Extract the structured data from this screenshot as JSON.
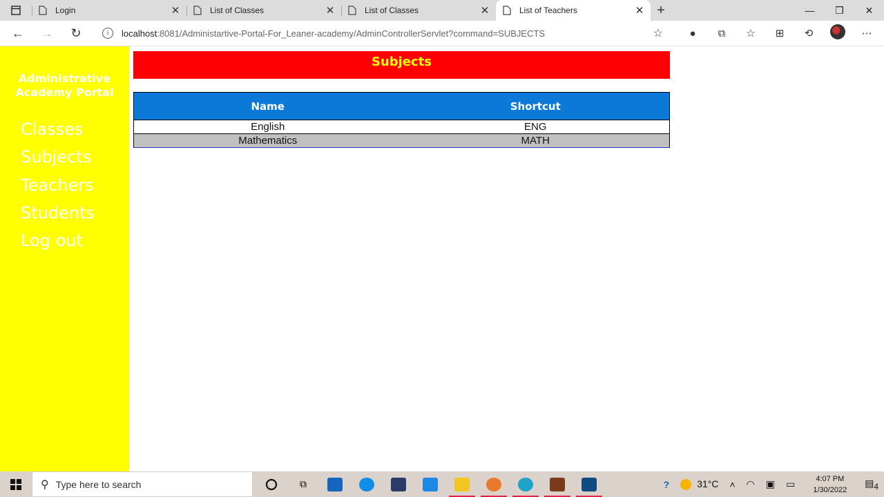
{
  "browser": {
    "tabs": [
      {
        "title": "Login",
        "active": false
      },
      {
        "title": "List of Classes",
        "active": false
      },
      {
        "title": "List of Classes",
        "active": false
      },
      {
        "title": "List of Teachers",
        "active": true
      }
    ],
    "url_host": "localhost",
    "url_rest": ":8081/Administartive-Portal-For_Leaner-academy/AdminControllerServlet?command=SUBJECTS"
  },
  "sidebar": {
    "brand_line1": "Administrative",
    "brand_line2": "Academy Portal",
    "items": [
      {
        "label": "Classes"
      },
      {
        "label": "Subjects"
      },
      {
        "label": "Teachers"
      },
      {
        "label": "Students"
      },
      {
        "label": "Log out"
      }
    ]
  },
  "main": {
    "heading": "Subjects",
    "table": {
      "headers": [
        "Name",
        "Shortcut"
      ],
      "rows": [
        [
          "English",
          "ENG"
        ],
        [
          "Mathematics",
          "MATH"
        ]
      ]
    }
  },
  "taskbar": {
    "search_placeholder": "Type here to search",
    "weather": "31°C",
    "time": "4:07 PM",
    "date": "1/30/2022",
    "notification_count": "4"
  },
  "colors": {
    "sidebar_bg": "#ffff00",
    "banner_bg": "#ff0000",
    "banner_text": "#ffff00",
    "table_header_bg": "#0b79d8",
    "row_alt_bg": "#c0c0c0"
  }
}
